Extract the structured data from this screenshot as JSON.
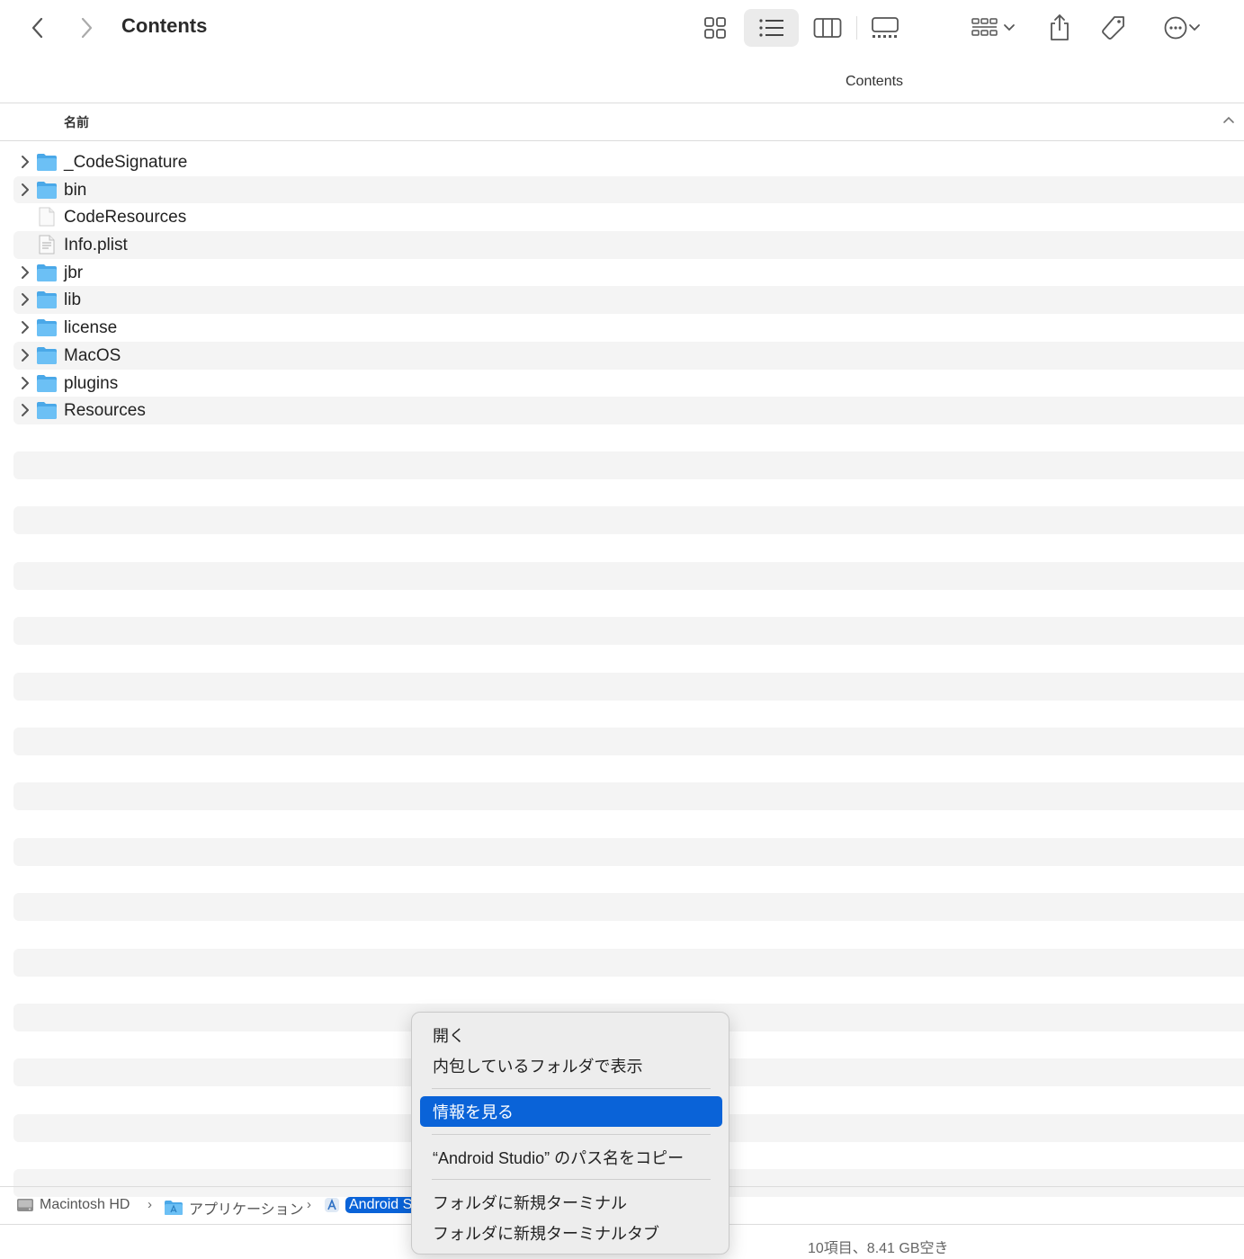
{
  "toolbar": {
    "title": "Contents",
    "back_icon": "chevron-left-icon",
    "forward_icon": "chevron-right-icon",
    "views": [
      "icon-view-icon",
      "list-view-icon",
      "column-view-icon",
      "gallery-view-icon"
    ],
    "active_view": "list-view-icon"
  },
  "path_title": "Contents",
  "header": {
    "name_column": "名前"
  },
  "files": [
    {
      "name": "_CodeSignature",
      "kind": "folder",
      "expandable": true
    },
    {
      "name": "bin",
      "kind": "folder",
      "expandable": true
    },
    {
      "name": "CodeResources",
      "kind": "file",
      "expandable": false
    },
    {
      "name": "Info.plist",
      "kind": "plist",
      "expandable": false
    },
    {
      "name": "jbr",
      "kind": "folder",
      "expandable": true
    },
    {
      "name": "lib",
      "kind": "folder",
      "expandable": true
    },
    {
      "name": "license",
      "kind": "folder",
      "expandable": true
    },
    {
      "name": "MacOS",
      "kind": "folder",
      "expandable": true
    },
    {
      "name": "plugins",
      "kind": "folder",
      "expandable": true
    },
    {
      "name": "Resources",
      "kind": "folder",
      "expandable": true
    }
  ],
  "pathbar": {
    "items": [
      {
        "label": "Macintosh HD",
        "icon": "hard-disk-icon"
      },
      {
        "label": "アプリケーション",
        "icon": "applications-folder-icon"
      },
      {
        "label": "Android S",
        "icon": "app-icon"
      }
    ],
    "separator": "›"
  },
  "status": {
    "text": "10項目、8.41 GB空き"
  },
  "context_menu": {
    "items": [
      {
        "label": "開く"
      },
      {
        "label": "内包しているフォルダで表示"
      },
      {
        "label": "情報を見る",
        "highlighted": true
      },
      {
        "label": "“Android Studio” のパス名をコピー"
      },
      {
        "label": "フォルダに新規ターミナル"
      },
      {
        "label": "フォルダに新規ターミナルタブ"
      }
    ]
  },
  "colors": {
    "accent": "#0a63d8",
    "folder": "#4aa8e8",
    "stripe": "#f4f4f4"
  }
}
